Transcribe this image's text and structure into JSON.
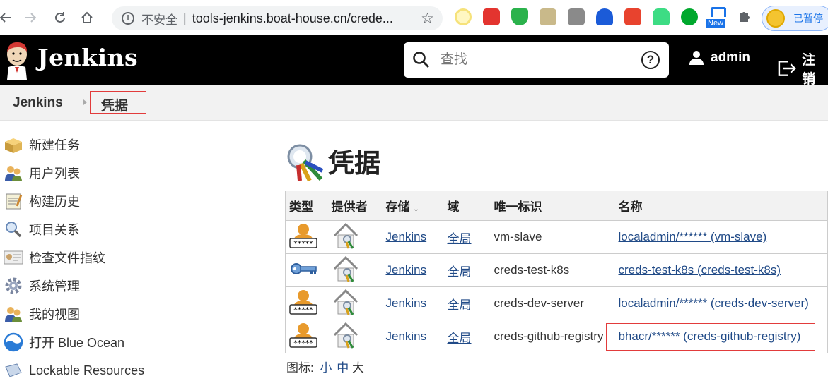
{
  "browser": {
    "insecure_label": "不安全",
    "separator": "|",
    "url": "tools-jenkins.boat-house.cn/crede...",
    "profile_label": "已暂停",
    "new_badge": "New"
  },
  "header": {
    "title": "Jenkins",
    "search_placeholder": "查找",
    "help_symbol": "?",
    "user": "admin",
    "logout": "注销"
  },
  "breadcrumb": {
    "home": "Jenkins",
    "current": "凭据"
  },
  "sidebar": {
    "items": [
      {
        "label": "新建任务",
        "icon": "new-package-icon"
      },
      {
        "label": "用户列表",
        "icon": "users-icon"
      },
      {
        "label": "构建历史",
        "icon": "notepad-icon"
      },
      {
        "label": "项目关系",
        "icon": "magnifier-icon"
      },
      {
        "label": "检查文件指纹",
        "icon": "fingerprint-card-icon"
      },
      {
        "label": "系统管理",
        "icon": "gear-icon"
      },
      {
        "label": "我的视图",
        "icon": "users-icon"
      },
      {
        "label": "打开 Blue Ocean",
        "icon": "blue-ocean-icon"
      },
      {
        "label": "Lockable Resources",
        "icon": "lockable-resources-icon"
      }
    ]
  },
  "main": {
    "title": "凭据",
    "table": {
      "headers": [
        "类型",
        "提供者",
        "存储 ↓",
        "域",
        "唯一标识",
        "名称"
      ],
      "rows": [
        {
          "type_icon": "user-password-icon",
          "store": "Jenkins",
          "domain": "全局",
          "id": "vm-slave",
          "name": "localadmin/****** (vm-slave)"
        },
        {
          "type_icon": "key-icon",
          "store": "Jenkins",
          "domain": "全局",
          "id": "creds-test-k8s",
          "name": "creds-test-k8s (creds-test-k8s)"
        },
        {
          "type_icon": "user-password-icon",
          "store": "Jenkins",
          "domain": "全局",
          "id": "creds-dev-server",
          "name": "localadmin/****** (creds-dev-server)"
        },
        {
          "type_icon": "user-password-icon",
          "store": "Jenkins",
          "domain": "全局",
          "id": "creds-github-registry",
          "name": "bhacr/****** (creds-github-registry)"
        }
      ]
    },
    "icon_size": {
      "label": "图标:",
      "small": "小",
      "medium": "中",
      "large": "大"
    }
  },
  "colors": {
    "header_bg": "#000000",
    "breadcrumb_bg": "#f2f2f2",
    "link": "#204a87",
    "highlight": "#e23b3b"
  }
}
